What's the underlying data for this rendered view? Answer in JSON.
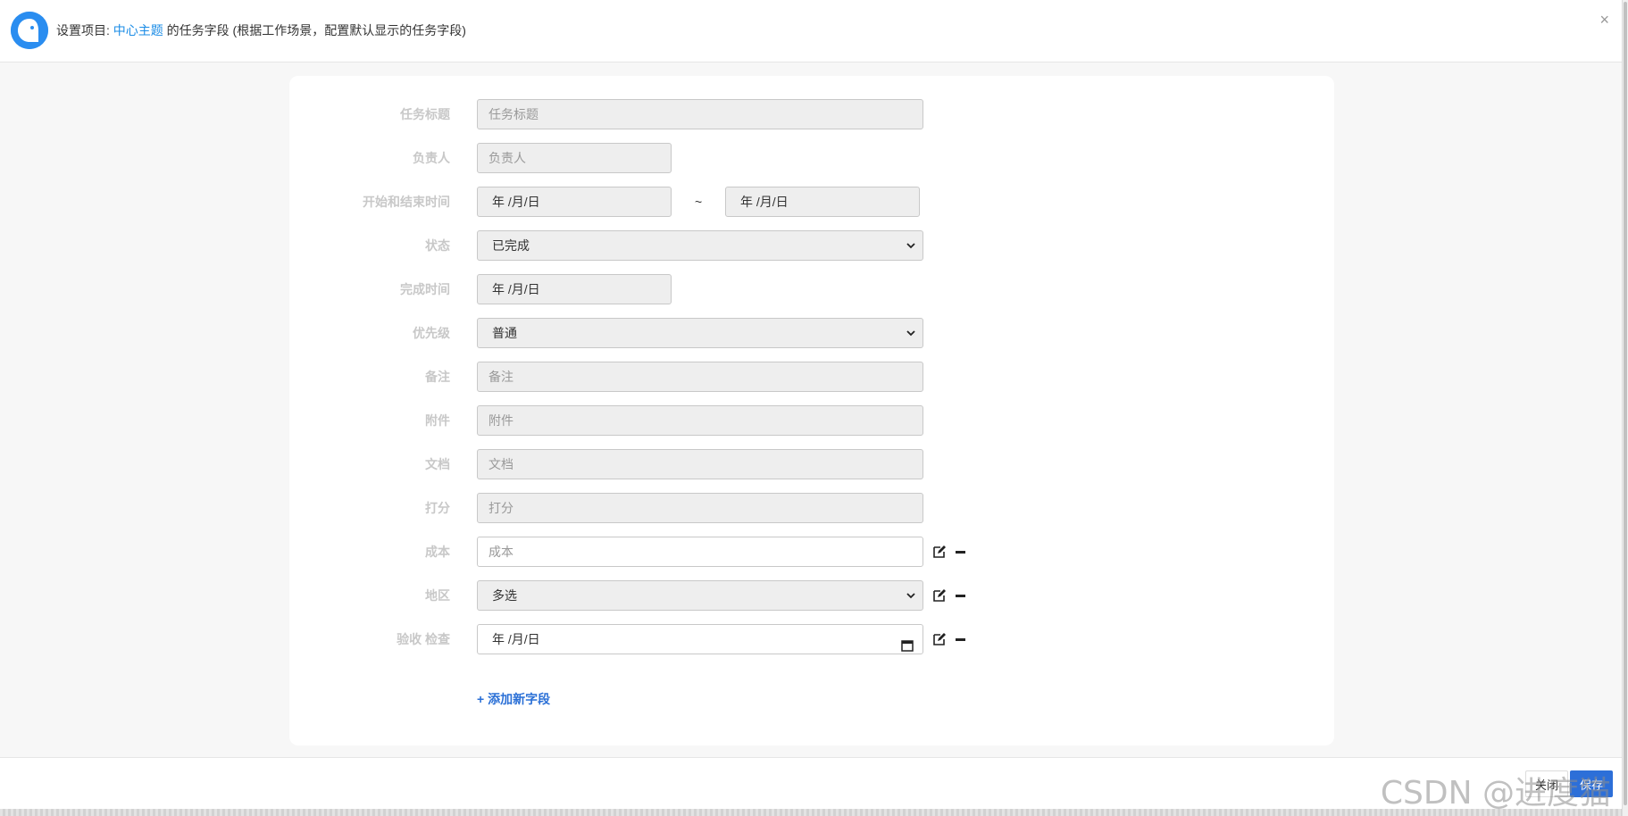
{
  "header": {
    "prefix": "设置项目: ",
    "project_link": "中心主题",
    "suffix": " 的任务字段 (根据工作场景，配置默认显示的任务字段)",
    "close_glyph": "×"
  },
  "fields": [
    {
      "label": "任务标题",
      "placeholder": "任务标题"
    },
    {
      "label": "负责人",
      "placeholder": "负责人"
    },
    {
      "label": "开始和结束时间",
      "start_value": "年 /月/日",
      "separator": "~",
      "end_value": "年 /月/日"
    },
    {
      "label": "状态",
      "value": "已完成"
    },
    {
      "label": "完成时间",
      "value": "年 /月/日"
    },
    {
      "label": "优先级",
      "value": "普通"
    },
    {
      "label": "备注",
      "placeholder": "备注"
    },
    {
      "label": "附件",
      "placeholder": "附件"
    },
    {
      "label": "文档",
      "placeholder": "文档"
    },
    {
      "label": "打分",
      "placeholder": "打分"
    },
    {
      "label": "成本",
      "placeholder": "成本"
    },
    {
      "label": "地区",
      "value": "多选"
    },
    {
      "label": "验收 检查",
      "value": "年 /月/日"
    }
  ],
  "add_field_label": "+ 添加新字段",
  "footer": {
    "close_label": "关闭",
    "save_label": "保存",
    "watermark": "CSDN @进度猫"
  }
}
